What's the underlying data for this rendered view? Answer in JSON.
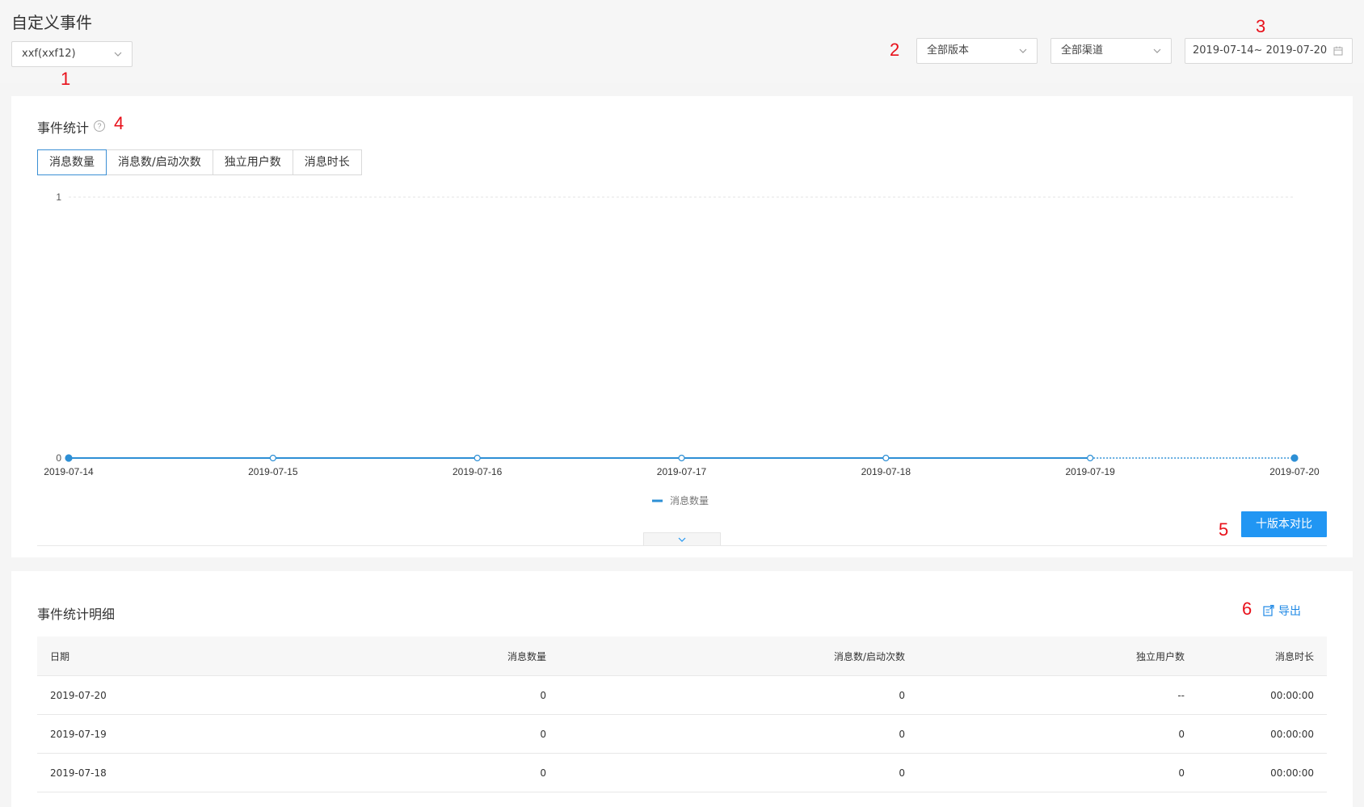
{
  "page": {
    "title": "自定义事件"
  },
  "filters": {
    "event_select": "xxf(xxf12)",
    "version_select": "全部版本",
    "channel_select": "全部渠道",
    "date_range": "2019-07-14~ 2019-07-20"
  },
  "annotations": [
    "1",
    "2",
    "3",
    "4",
    "5",
    "6"
  ],
  "stats": {
    "title": "事件统计",
    "help": "?",
    "tabs": [
      {
        "label": "消息数量",
        "active": true
      },
      {
        "label": "消息数/启动次数",
        "active": false
      },
      {
        "label": "独立用户数",
        "active": false
      },
      {
        "label": "消息时长",
        "active": false
      }
    ],
    "compare_button": "十版本对比"
  },
  "chart_data": {
    "type": "line",
    "x": [
      "2019-07-14",
      "2019-07-15",
      "2019-07-16",
      "2019-07-17",
      "2019-07-18",
      "2019-07-19",
      "2019-07-20"
    ],
    "series": [
      {
        "name": "消息数量",
        "values": [
          0,
          0,
          0,
          0,
          0,
          0,
          0
        ],
        "color": "#2d8fd5"
      }
    ],
    "ylim": [
      0,
      1
    ],
    "yticks": [
      "0",
      "1"
    ],
    "grid": true,
    "legend": "bottom-center",
    "dashed_last_segment": true
  },
  "detail": {
    "title": "事件统计明细",
    "export_label": "导出",
    "columns": [
      "日期",
      "消息数量",
      "消息数/启动次数",
      "独立用户数",
      "消息时长"
    ],
    "rows": [
      [
        "2019-07-20",
        "0",
        "0",
        "--",
        "00:00:00"
      ],
      [
        "2019-07-19",
        "0",
        "0",
        "0",
        "00:00:00"
      ],
      [
        "2019-07-18",
        "0",
        "0",
        "0",
        "00:00:00"
      ]
    ]
  },
  "colors": {
    "accent": "#2196f3",
    "annotation": "#e8101a"
  }
}
